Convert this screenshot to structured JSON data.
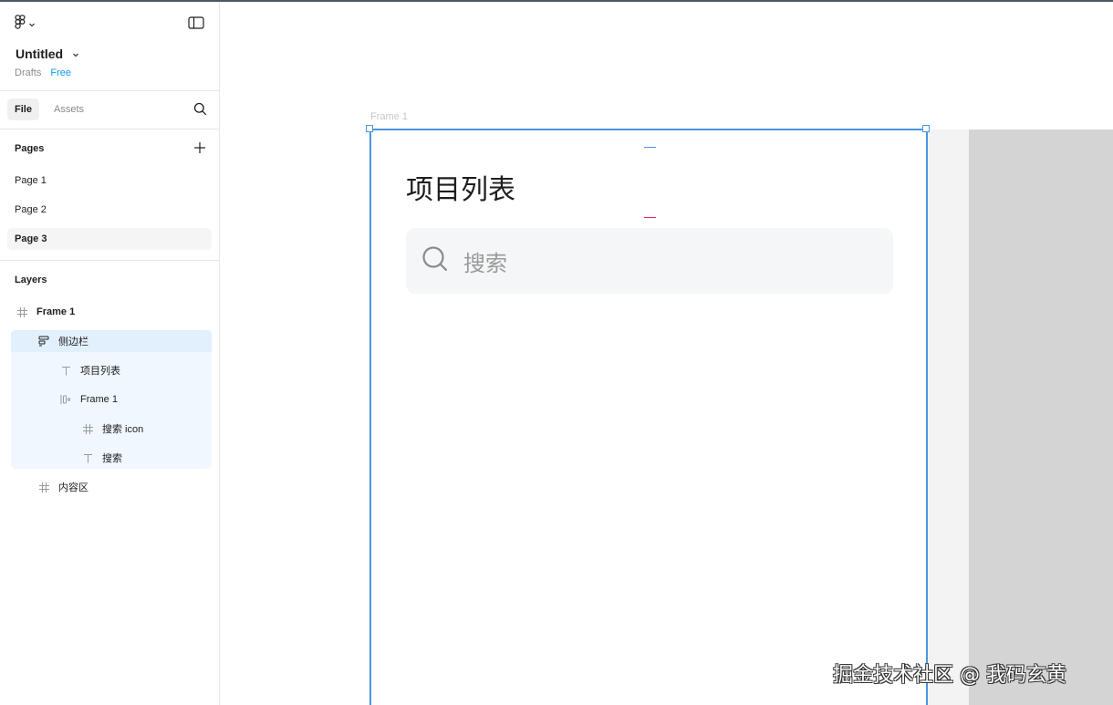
{
  "app": {
    "file_title": "Untitled",
    "location": "Drafts",
    "plan_badge": "Free"
  },
  "tabs": [
    {
      "label": "File",
      "active": true
    },
    {
      "label": "Assets",
      "active": false
    }
  ],
  "pages": {
    "heading": "Pages",
    "items": [
      {
        "label": "Page 1",
        "active": false
      },
      {
        "label": "Page 2",
        "active": false
      },
      {
        "label": "Page 3",
        "active": true
      }
    ]
  },
  "layers": {
    "heading": "Layers",
    "items": [
      {
        "label": "Frame 1",
        "icon": "frame-icon",
        "depth": 0
      },
      {
        "label": "侧边栏",
        "icon": "auto-layout-icon",
        "depth": 1,
        "selected": true
      },
      {
        "label": "项目列表",
        "icon": "text-icon",
        "depth": 2
      },
      {
        "label": "Frame 1",
        "icon": "auto-layout-horizontal-icon",
        "depth": 2
      },
      {
        "label": "搜索 icon",
        "icon": "frame-icon",
        "depth": 3
      },
      {
        "label": "搜索",
        "icon": "text-icon",
        "depth": 3
      },
      {
        "label": "内容区",
        "icon": "frame-icon",
        "depth": 1
      }
    ]
  },
  "canvas": {
    "frame_label": "Frame 1",
    "title": "项目列表",
    "search_placeholder": "搜索"
  },
  "watermark": "掘金技术社区 @ 我码玄黄",
  "colors": {
    "selection": "#4a96e0",
    "accent": "#0d99ff",
    "layer_selected_bg": "#e2f0fd"
  }
}
